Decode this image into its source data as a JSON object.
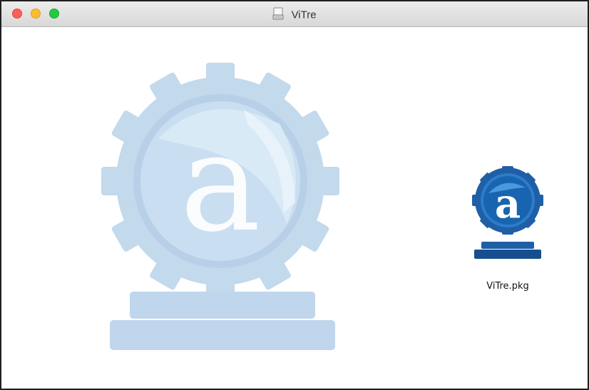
{
  "window": {
    "title": "ViTre",
    "title_icon": "disk-image-icon",
    "controls": [
      "close",
      "minimize",
      "zoom"
    ]
  },
  "content": {
    "background_art": "installer-logo-watermark",
    "items": [
      {
        "label": "ViTre.pkg",
        "icon": "package-installer-icon"
      }
    ]
  },
  "colors": {
    "close": "#fc5f57",
    "minimize": "#fdbc2e",
    "zoom": "#28c840",
    "watermark": "#c3d9ec",
    "icon_blue": "#1d6ab4"
  }
}
